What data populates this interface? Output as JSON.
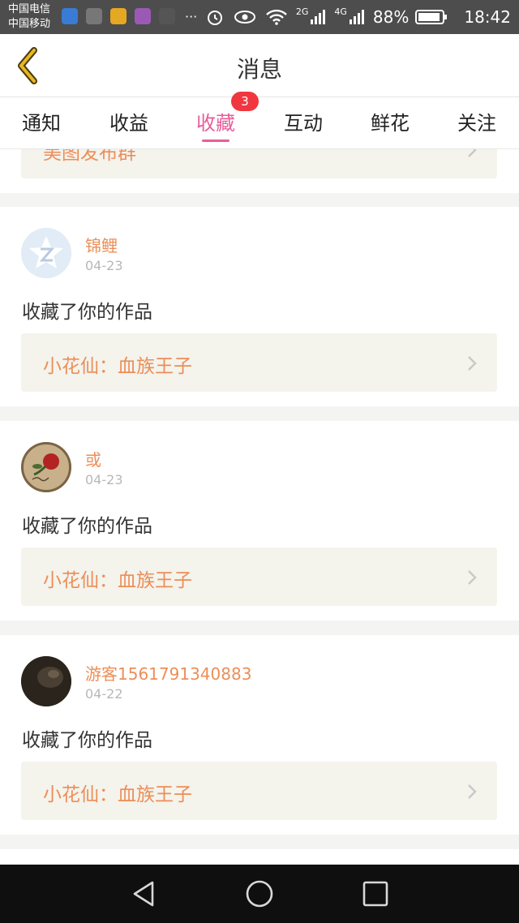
{
  "status_bar": {
    "carrier_1": "中国电信",
    "carrier_2": "中国移动",
    "more": "···",
    "signal_2g": "2G",
    "signal_4g": "4G",
    "battery": "88%",
    "time": "18:42"
  },
  "header": {
    "title": "消息",
    "back_icon": "back-chevron-icon"
  },
  "tabs": [
    {
      "label": "通知"
    },
    {
      "label": "收益"
    },
    {
      "label": "收藏",
      "active": true,
      "badge": "3"
    },
    {
      "label": "互动"
    },
    {
      "label": "鲜花"
    },
    {
      "label": "关注"
    }
  ],
  "partial_item": {
    "work_title": "美图发布群"
  },
  "items": [
    {
      "user": "锦鲤",
      "date": "04-23",
      "action": "收藏了你的作品",
      "work_title": "小花仙：血族王子"
    },
    {
      "user": "或",
      "date": "04-23",
      "action": "收藏了你的作品",
      "work_title": "小花仙：血族王子"
    },
    {
      "user": "游客1561791340883",
      "date": "04-22",
      "action": "收藏了你的作品",
      "work_title": "小花仙：血族王子"
    }
  ],
  "colors": {
    "accent": "#e85d9a",
    "username": "#ec8e58",
    "badge": "#f0373f",
    "back_icon": "#e8b820"
  }
}
